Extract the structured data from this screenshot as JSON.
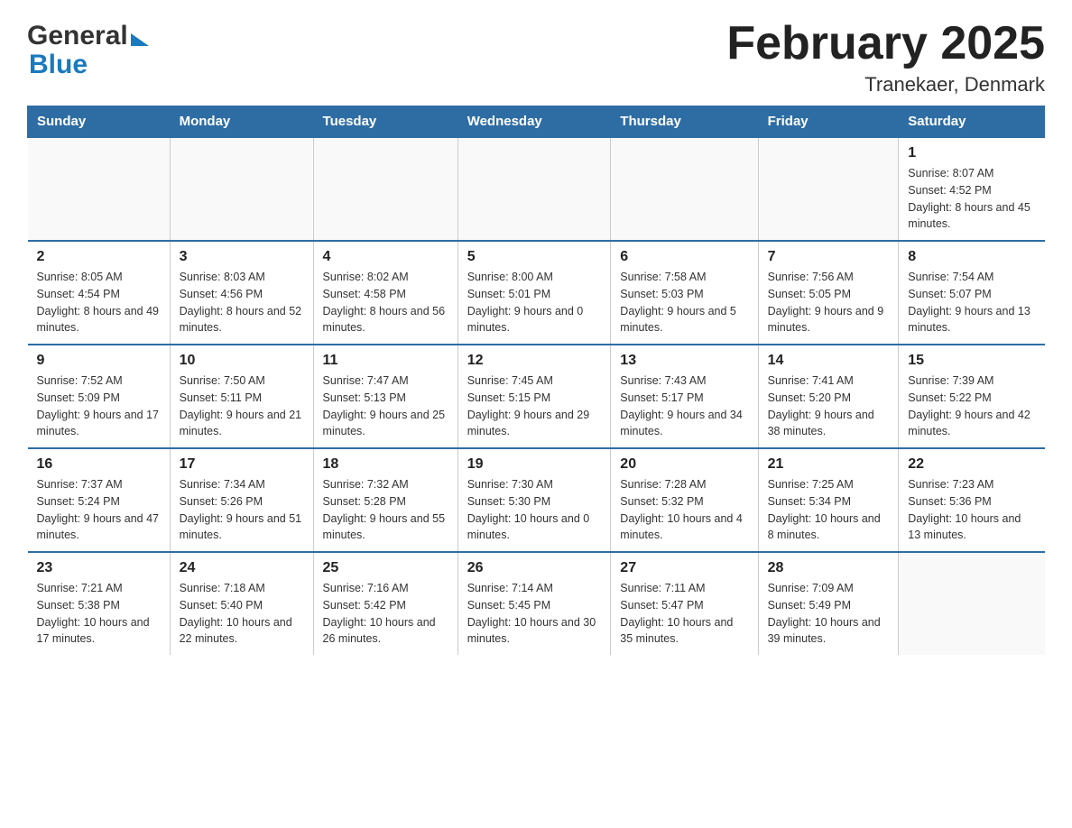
{
  "header": {
    "logo_general": "General",
    "logo_blue": "Blue",
    "title": "February 2025",
    "location": "Tranekaer, Denmark"
  },
  "calendar": {
    "weekdays": [
      "Sunday",
      "Monday",
      "Tuesday",
      "Wednesday",
      "Thursday",
      "Friday",
      "Saturday"
    ],
    "weeks": [
      [
        {
          "day": "",
          "info": ""
        },
        {
          "day": "",
          "info": ""
        },
        {
          "day": "",
          "info": ""
        },
        {
          "day": "",
          "info": ""
        },
        {
          "day": "",
          "info": ""
        },
        {
          "day": "",
          "info": ""
        },
        {
          "day": "1",
          "info": "Sunrise: 8:07 AM\nSunset: 4:52 PM\nDaylight: 8 hours and 45 minutes."
        }
      ],
      [
        {
          "day": "2",
          "info": "Sunrise: 8:05 AM\nSunset: 4:54 PM\nDaylight: 8 hours and 49 minutes."
        },
        {
          "day": "3",
          "info": "Sunrise: 8:03 AM\nSunset: 4:56 PM\nDaylight: 8 hours and 52 minutes."
        },
        {
          "day": "4",
          "info": "Sunrise: 8:02 AM\nSunset: 4:58 PM\nDaylight: 8 hours and 56 minutes."
        },
        {
          "day": "5",
          "info": "Sunrise: 8:00 AM\nSunset: 5:01 PM\nDaylight: 9 hours and 0 minutes."
        },
        {
          "day": "6",
          "info": "Sunrise: 7:58 AM\nSunset: 5:03 PM\nDaylight: 9 hours and 5 minutes."
        },
        {
          "day": "7",
          "info": "Sunrise: 7:56 AM\nSunset: 5:05 PM\nDaylight: 9 hours and 9 minutes."
        },
        {
          "day": "8",
          "info": "Sunrise: 7:54 AM\nSunset: 5:07 PM\nDaylight: 9 hours and 13 minutes."
        }
      ],
      [
        {
          "day": "9",
          "info": "Sunrise: 7:52 AM\nSunset: 5:09 PM\nDaylight: 9 hours and 17 minutes."
        },
        {
          "day": "10",
          "info": "Sunrise: 7:50 AM\nSunset: 5:11 PM\nDaylight: 9 hours and 21 minutes."
        },
        {
          "day": "11",
          "info": "Sunrise: 7:47 AM\nSunset: 5:13 PM\nDaylight: 9 hours and 25 minutes."
        },
        {
          "day": "12",
          "info": "Sunrise: 7:45 AM\nSunset: 5:15 PM\nDaylight: 9 hours and 29 minutes."
        },
        {
          "day": "13",
          "info": "Sunrise: 7:43 AM\nSunset: 5:17 PM\nDaylight: 9 hours and 34 minutes."
        },
        {
          "day": "14",
          "info": "Sunrise: 7:41 AM\nSunset: 5:20 PM\nDaylight: 9 hours and 38 minutes."
        },
        {
          "day": "15",
          "info": "Sunrise: 7:39 AM\nSunset: 5:22 PM\nDaylight: 9 hours and 42 minutes."
        }
      ],
      [
        {
          "day": "16",
          "info": "Sunrise: 7:37 AM\nSunset: 5:24 PM\nDaylight: 9 hours and 47 minutes."
        },
        {
          "day": "17",
          "info": "Sunrise: 7:34 AM\nSunset: 5:26 PM\nDaylight: 9 hours and 51 minutes."
        },
        {
          "day": "18",
          "info": "Sunrise: 7:32 AM\nSunset: 5:28 PM\nDaylight: 9 hours and 55 minutes."
        },
        {
          "day": "19",
          "info": "Sunrise: 7:30 AM\nSunset: 5:30 PM\nDaylight: 10 hours and 0 minutes."
        },
        {
          "day": "20",
          "info": "Sunrise: 7:28 AM\nSunset: 5:32 PM\nDaylight: 10 hours and 4 minutes."
        },
        {
          "day": "21",
          "info": "Sunrise: 7:25 AM\nSunset: 5:34 PM\nDaylight: 10 hours and 8 minutes."
        },
        {
          "day": "22",
          "info": "Sunrise: 7:23 AM\nSunset: 5:36 PM\nDaylight: 10 hours and 13 minutes."
        }
      ],
      [
        {
          "day": "23",
          "info": "Sunrise: 7:21 AM\nSunset: 5:38 PM\nDaylight: 10 hours and 17 minutes."
        },
        {
          "day": "24",
          "info": "Sunrise: 7:18 AM\nSunset: 5:40 PM\nDaylight: 10 hours and 22 minutes."
        },
        {
          "day": "25",
          "info": "Sunrise: 7:16 AM\nSunset: 5:42 PM\nDaylight: 10 hours and 26 minutes."
        },
        {
          "day": "26",
          "info": "Sunrise: 7:14 AM\nSunset: 5:45 PM\nDaylight: 10 hours and 30 minutes."
        },
        {
          "day": "27",
          "info": "Sunrise: 7:11 AM\nSunset: 5:47 PM\nDaylight: 10 hours and 35 minutes."
        },
        {
          "day": "28",
          "info": "Sunrise: 7:09 AM\nSunset: 5:49 PM\nDaylight: 10 hours and 39 minutes."
        },
        {
          "day": "",
          "info": ""
        }
      ]
    ]
  }
}
